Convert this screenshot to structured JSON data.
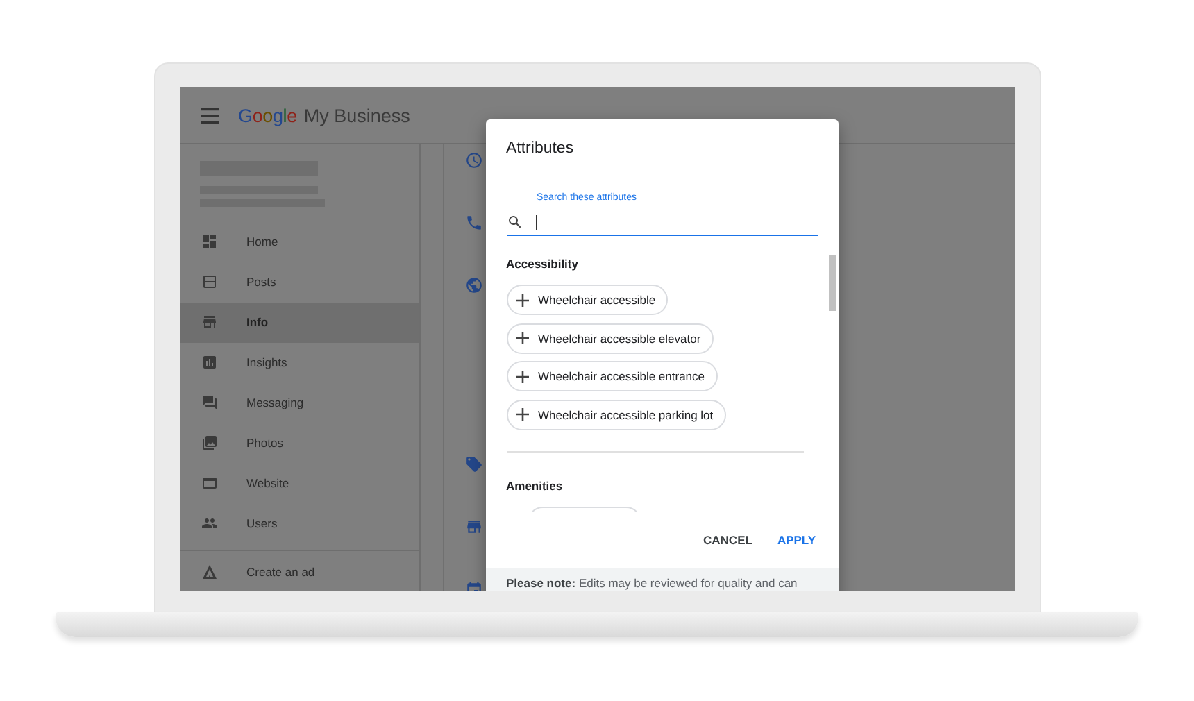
{
  "app": {
    "logo": {
      "brand": "Google",
      "product": "My Business"
    }
  },
  "sidebar": {
    "items": [
      {
        "label": "Home",
        "selected": false
      },
      {
        "label": "Posts",
        "selected": false
      },
      {
        "label": "Info",
        "selected": true
      },
      {
        "label": "Insights",
        "selected": false
      },
      {
        "label": "Messaging",
        "selected": false
      },
      {
        "label": "Photos",
        "selected": false
      },
      {
        "label": "Website",
        "selected": false
      },
      {
        "label": "Users",
        "selected": false
      }
    ],
    "footer_item": {
      "label": "Create an ad"
    }
  },
  "dialog": {
    "title": "Attributes",
    "search": {
      "label": "Search these attributes"
    },
    "sections": [
      {
        "heading": "Accessibility",
        "chips": [
          {
            "label": "Wheelchair accessible"
          },
          {
            "label": "Wheelchair accessible elevator"
          },
          {
            "label": "Wheelchair accessible entrance"
          },
          {
            "label": "Wheelchair accessible parking lot"
          }
        ]
      },
      {
        "heading": "Amenities"
      }
    ],
    "actions": [
      {
        "label": "CANCEL",
        "kind": "secondary"
      },
      {
        "label": "APPLY",
        "kind": "primary"
      }
    ],
    "note": "**Please note:** Edits may be reviewed for quality and can"
  }
}
